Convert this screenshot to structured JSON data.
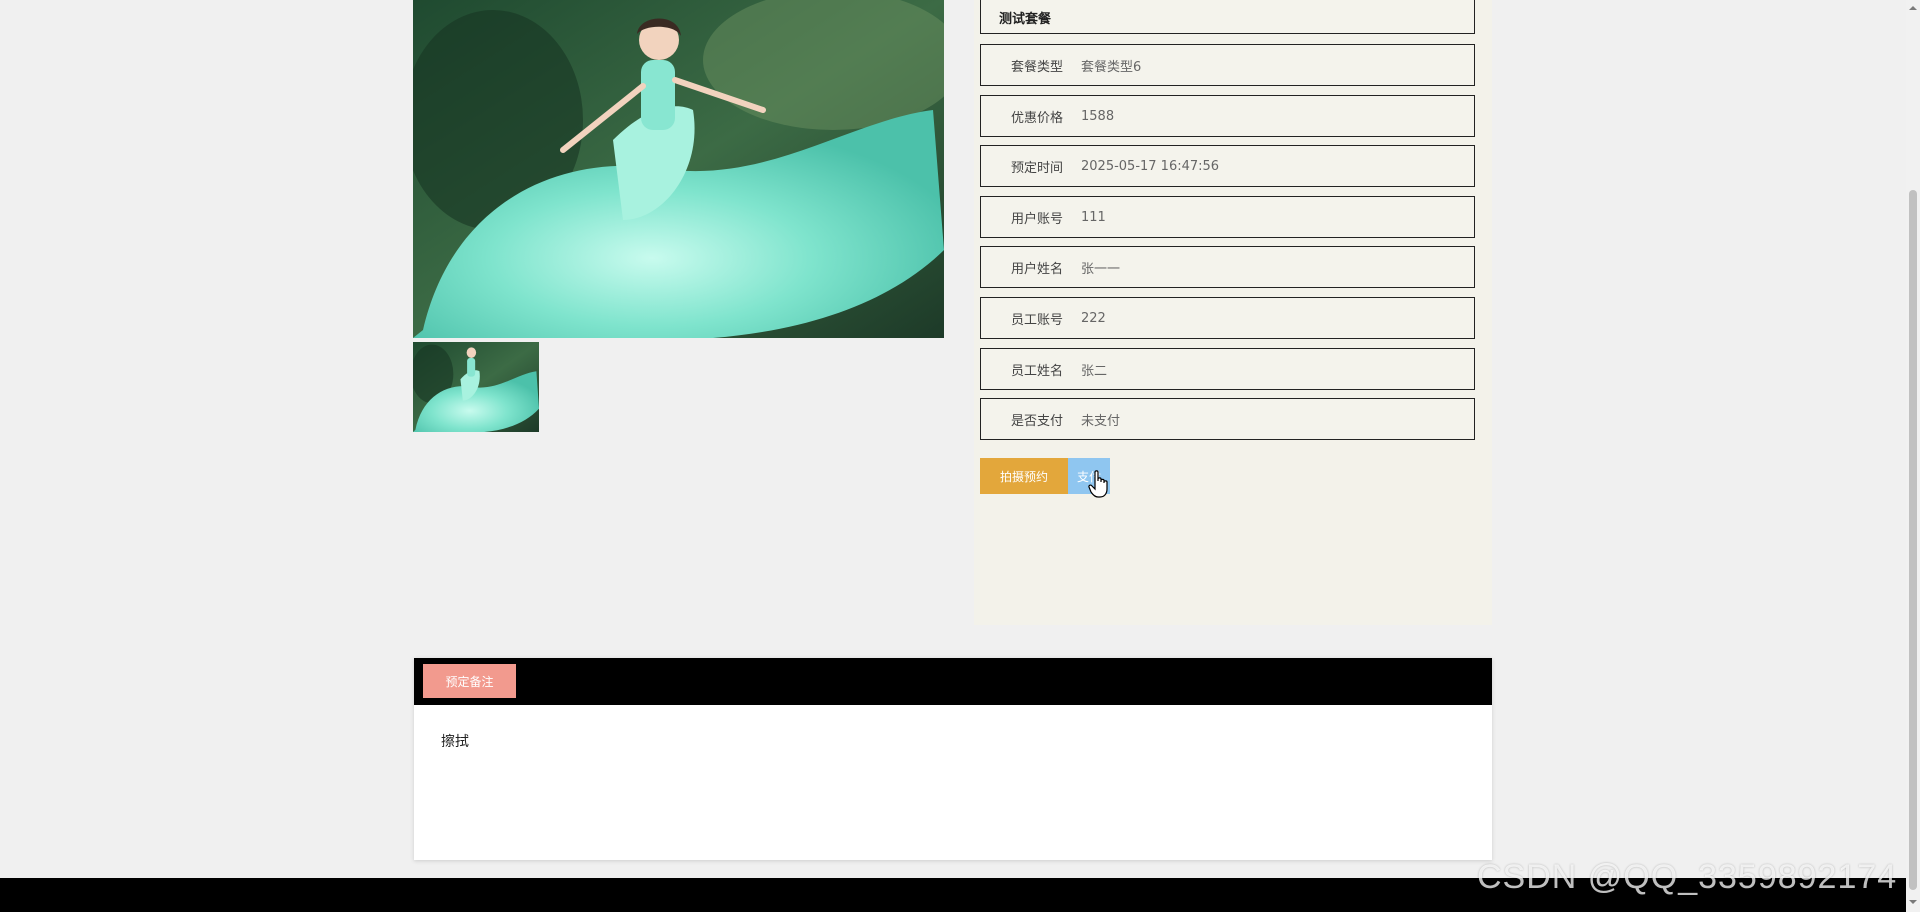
{
  "package": {
    "title": "测试套餐",
    "fields": [
      {
        "label": "套餐类型",
        "value": "套餐类型6"
      },
      {
        "label": "优惠价格",
        "value": "1588"
      },
      {
        "label": "预定时间",
        "value": "2025-05-17 16:47:56"
      },
      {
        "label": "用户账号",
        "value": "111"
      },
      {
        "label": "用户姓名",
        "value": "张一一"
      },
      {
        "label": "员工账号",
        "value": "222"
      },
      {
        "label": "员工姓名",
        "value": "张二"
      },
      {
        "label": "是否支付",
        "value": "未支付"
      }
    ]
  },
  "actions": {
    "book_label": "拍摄预约",
    "pay_label": "支付"
  },
  "remark": {
    "tab_label": "预定备注",
    "content": "擦拭"
  },
  "watermark": "CSDN @QQ_3359892174",
  "colors": {
    "book_button": "#e3a73b",
    "pay_button": "#8fc6f0",
    "remark_tab": "#f29a8e",
    "remark_header": "#000000"
  },
  "icons": {
    "cursor": "hand-pointer-icon",
    "scroll_up": "chevron-up-icon",
    "scroll_down": "chevron-down-icon"
  }
}
